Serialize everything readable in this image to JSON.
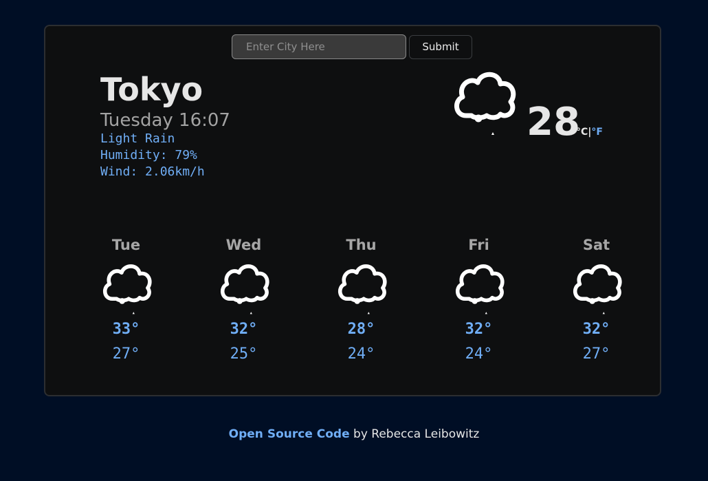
{
  "search": {
    "placeholder": "Enter City Here",
    "value": "",
    "submit_label": "Submit"
  },
  "current": {
    "city": "Tokyo",
    "datetime": "Tuesday 16:07",
    "description": "Light Rain",
    "humidity": "Humidity: 79%",
    "wind": "Wind: 2.06km/h",
    "temperature": "28",
    "icon": "cloud-rain-icon",
    "unit_celsius": "°C",
    "unit_separator": "|",
    "unit_fahrenheit": "°F",
    "active_unit": "C"
  },
  "forecast": [
    {
      "day": "Tue",
      "max": "33°",
      "min": "27°",
      "icon": "cloud-rain-icon"
    },
    {
      "day": "Wed",
      "max": "32°",
      "min": "25°",
      "icon": "cloud-rain-icon"
    },
    {
      "day": "Thu",
      "max": "28°",
      "min": "24°",
      "icon": "cloud-rain-icon"
    },
    {
      "day": "Fri",
      "max": "32°",
      "min": "24°",
      "icon": "cloud-rain-icon"
    },
    {
      "day": "Sat",
      "max": "32°",
      "min": "27°",
      "icon": "cloud-rain-icon"
    }
  ],
  "footer": {
    "link_label": "Open Source Code",
    "suffix": " by Rebecca Leibowitz"
  },
  "colors": {
    "background": "#000e25",
    "card": "#0e0f10",
    "accent": "#70aef6",
    "text": "#e6e6e6",
    "muted": "#a6a6a6"
  }
}
